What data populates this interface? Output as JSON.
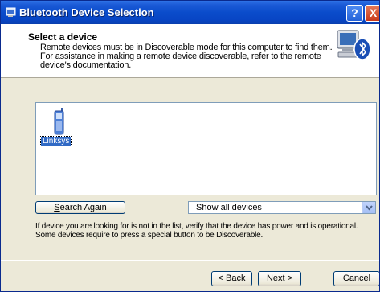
{
  "window": {
    "title": "Bluetooth Device Selection",
    "help_symbol": "?",
    "close_symbol": "X"
  },
  "header": {
    "title": "Select a device",
    "desc_line1": "Remote devices must be in Discoverable mode for this computer to find them.",
    "desc_line2": "For assistance in making a remote device discoverable, refer to the remote",
    "desc_line3": "device's documentation.",
    "icon": "bluetooth-computer-icon"
  },
  "device_list": {
    "items": [
      {
        "label": "Linksys",
        "icon": "mobile-phone-icon",
        "selected": true
      }
    ]
  },
  "controls": {
    "search_again_prefix": "",
    "search_again_mnemonic": "S",
    "search_again_rest": "earch Again",
    "filter_value": "Show all devices"
  },
  "info": {
    "line1": "If device you are looking for is not in the list, verify that the device has power and is operational.",
    "line2": "Some devices require to press a special button to be Discoverable."
  },
  "buttons": {
    "back_prefix": "< ",
    "back_mnemonic": "B",
    "back_rest": "ack",
    "next_mnemonic": "N",
    "next_rest": "ext >",
    "cancel": "Cancel"
  },
  "colors": {
    "titlebar": "#0a4ccb",
    "selection": "#316ac5",
    "dialog_bg": "#ece9d8"
  }
}
